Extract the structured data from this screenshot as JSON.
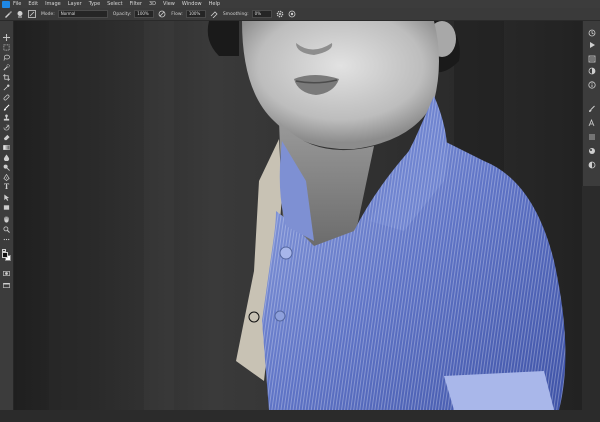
{
  "menu": {
    "items": [
      "File",
      "Edit",
      "Image",
      "Layer",
      "Type",
      "Select",
      "Filter",
      "3D",
      "View",
      "Window",
      "Help"
    ]
  },
  "options_bar": {
    "mode_label": "Mode:",
    "mode_value": "Normal",
    "opacity_label": "Opacity:",
    "opacity_value": "100%",
    "flow_label": "Flow:",
    "flow_value": "100%",
    "smoothing_label": "Smoothing:",
    "smoothing_value": "0%"
  },
  "tools": [
    {
      "name": "move-tool",
      "icon": "move-icon"
    },
    {
      "name": "marquee-tool",
      "icon": "marquee-icon"
    },
    {
      "name": "lasso-tool",
      "icon": "lasso-icon"
    },
    {
      "name": "quick-select-tool",
      "icon": "quick-select-icon"
    },
    {
      "name": "crop-tool",
      "icon": "crop-icon"
    },
    {
      "name": "eyedropper-tool",
      "icon": "eyedropper-icon"
    },
    {
      "name": "healing-tool",
      "icon": "bandage-icon"
    },
    {
      "name": "brush-tool",
      "icon": "brush-icon"
    },
    {
      "name": "stamp-tool",
      "icon": "stamp-icon"
    },
    {
      "name": "history-brush-tool",
      "icon": "history-brush-icon"
    },
    {
      "name": "eraser-tool",
      "icon": "eraser-icon"
    },
    {
      "name": "gradient-tool",
      "icon": "gradient-icon"
    },
    {
      "name": "blur-tool",
      "icon": "blur-drop-icon"
    },
    {
      "name": "dodge-tool",
      "icon": "dodge-icon"
    },
    {
      "name": "pen-tool",
      "icon": "pen-icon"
    },
    {
      "name": "type-tool",
      "icon": "type-icon"
    },
    {
      "name": "path-select-tool",
      "icon": "arrow-icon"
    },
    {
      "name": "shape-tool",
      "icon": "rectangle-icon"
    },
    {
      "name": "hand-tool",
      "icon": "hand-icon"
    },
    {
      "name": "zoom-tool",
      "icon": "zoom-icon"
    }
  ],
  "type_tool_glyph": "T",
  "right_panel": [
    {
      "name": "history-panel",
      "icon": "history-icon"
    },
    {
      "name": "actions-panel",
      "icon": "play-icon"
    },
    {
      "name": "properties-panel",
      "icon": "properties-icon"
    },
    {
      "name": "adjustments-panel",
      "icon": "adjustments-icon"
    },
    {
      "name": "info-panel",
      "icon": "info-icon"
    },
    {
      "name": "brushes-panel",
      "icon": "brush-settings-icon"
    },
    {
      "name": "character-panel",
      "icon": "character-icon"
    },
    {
      "name": "channels-panel",
      "icon": "channels-icon"
    },
    {
      "name": "styles-panel",
      "icon": "styles-icon"
    },
    {
      "name": "color-panel",
      "icon": "color-icon"
    }
  ],
  "colors": {
    "foreground": "#111111",
    "background": "#ffffff",
    "shirt_tint": "#4d63b8",
    "chrome": "#3c3c3c"
  }
}
